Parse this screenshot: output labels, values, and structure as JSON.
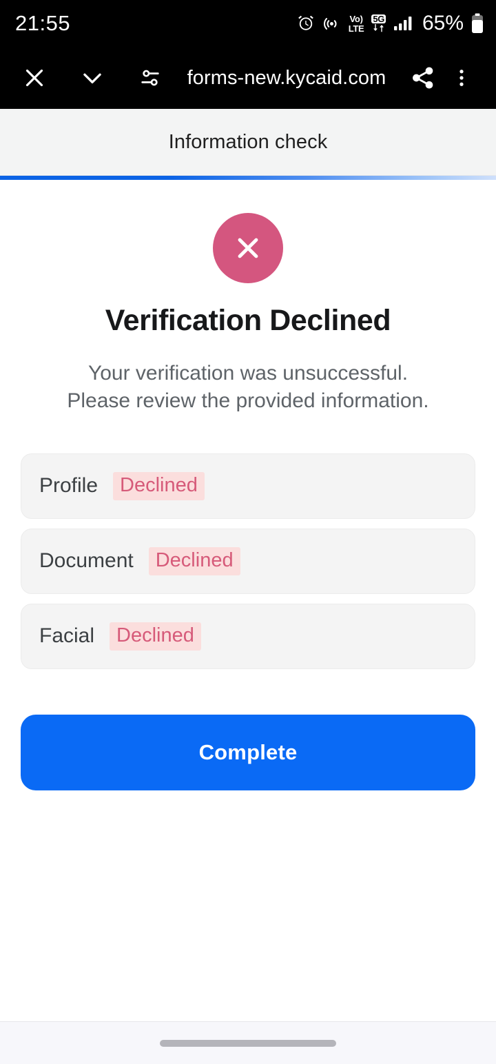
{
  "status_bar": {
    "time": "21:55",
    "battery_percent": "65%",
    "network_voice": "Vo)",
    "network_lte": "LTE",
    "network_5g": "5G",
    "icons": [
      "alarm-icon",
      "hotspot-icon",
      "volte-icon",
      "fiveg-data-icon",
      "signal-bars-icon",
      "battery-icon"
    ]
  },
  "browser_bar": {
    "url": "forms-new.kycaid.com",
    "close_label": "Close",
    "collapse_label": "Collapse",
    "page_info_label": "Page info",
    "share_label": "Share",
    "menu_label": "More options"
  },
  "page_header": {
    "title": "Information check",
    "progress_start_color": "#0b63e5",
    "progress_end_color": "#cfe0fb"
  },
  "result": {
    "icon": "circle-x-icon",
    "icon_color": "#d4567f",
    "title": "Verification Declined",
    "description": "Your verification was unsuccessful. Please review the provided information."
  },
  "checks": {
    "rows": [
      {
        "label": "Profile",
        "status": "Declined"
      },
      {
        "label": "Document",
        "status": "Declined"
      },
      {
        "label": "Facial",
        "status": "Declined"
      }
    ],
    "status_text_color": "#d65a79",
    "status_bg_color": "#fbdedd"
  },
  "cta": {
    "label": "Complete",
    "color": "#0a6af5"
  },
  "nav_bar": {
    "handle": "home-gesture-handle"
  }
}
